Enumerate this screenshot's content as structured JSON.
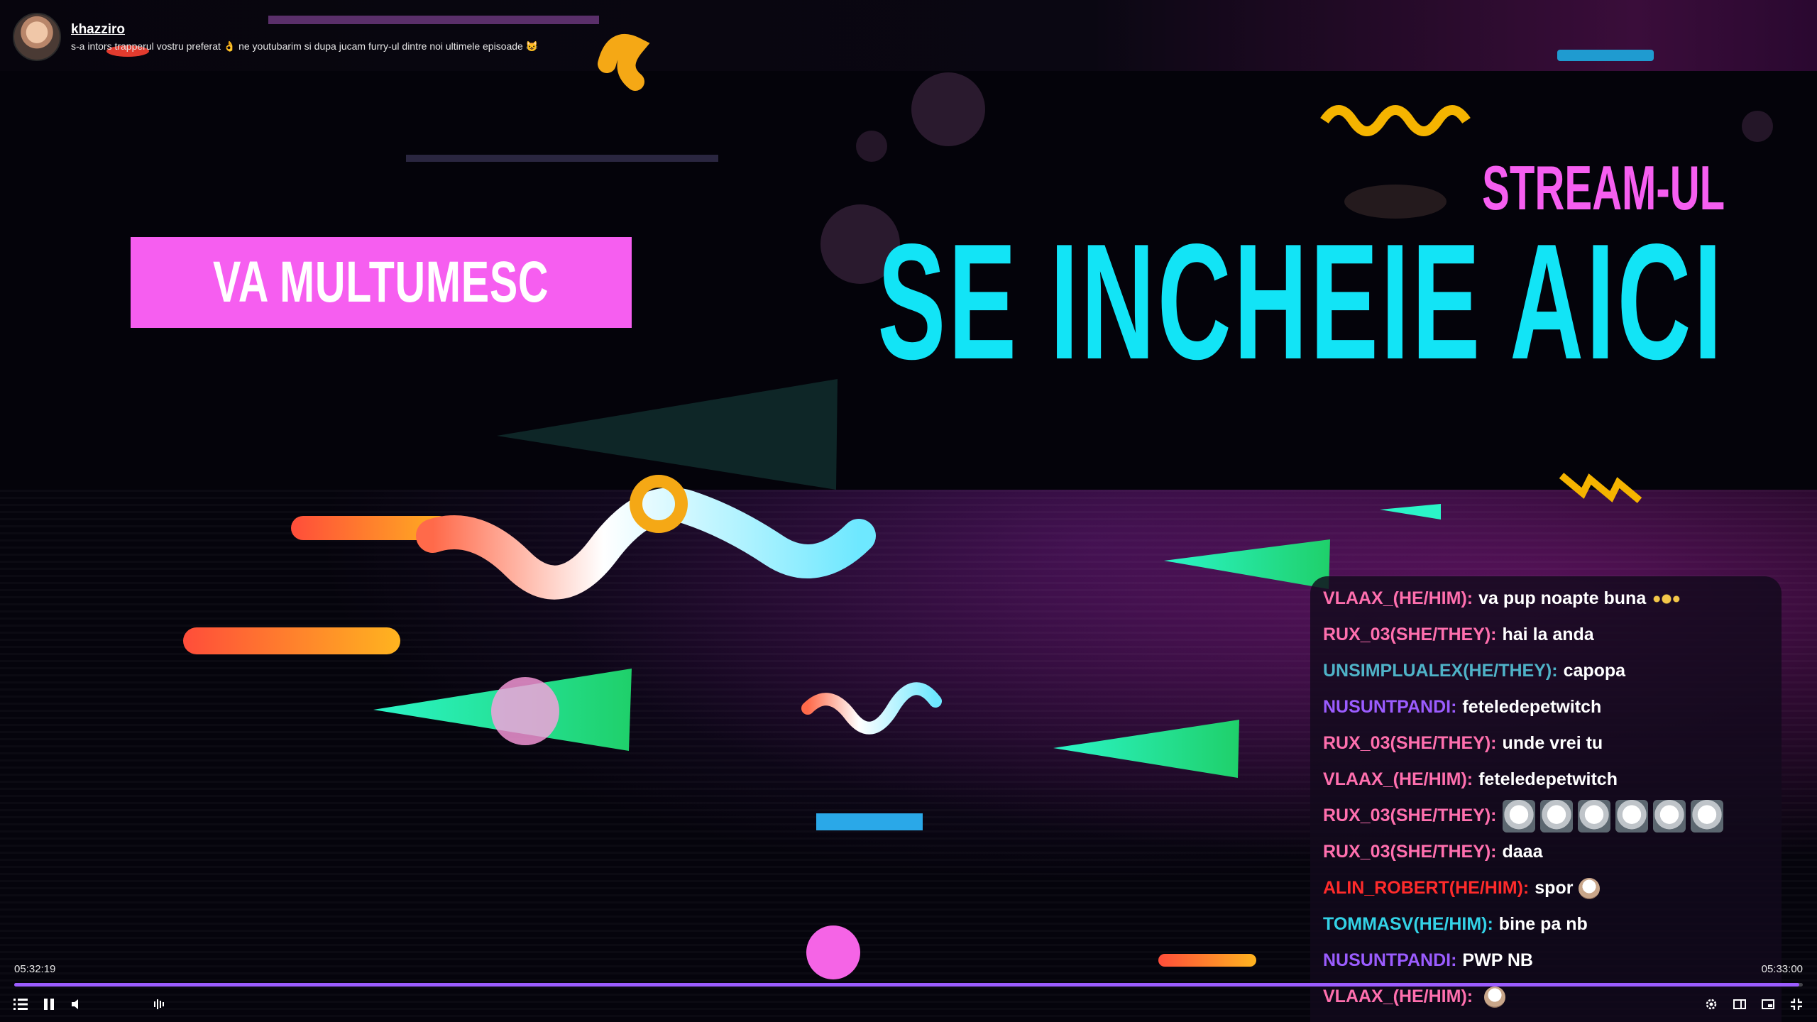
{
  "header": {
    "channel": "khazziro",
    "title": "s-a intors trapperul vostru preferat 👌 ne youtubarim si dupa jucam furry-ul dintre noi ultimele episoade 😺"
  },
  "scene": {
    "banner_text": "VA MULTUMESC",
    "heading_small": "STREAM-UL",
    "heading_big": "SE INCHEIE AICI"
  },
  "chat": [
    {
      "user": "VLAAX_(HE/HIM):",
      "color": "#ff6fae",
      "msg": "va pup noapte buna",
      "emote": "dots"
    },
    {
      "user": "RUX_03(SHE/THEY):",
      "color": "#ff6fae",
      "msg": "hai la anda"
    },
    {
      "user": "UNSIMPLUALEX(HE/THEY):",
      "color": "#4fb3c8",
      "msg": "capopa"
    },
    {
      "user": "NUSUNTPANDI:",
      "color": "#9b5cff",
      "msg": "feteledepetwitch"
    },
    {
      "user": "RUX_03(SHE/THEY):",
      "color": "#ff6fae",
      "msg": "unde vrei tu"
    },
    {
      "user": "VLAAX_(HE/HIM):",
      "color": "#ff6fae",
      "msg": "feteledepetwitch"
    },
    {
      "user": "RUX_03(SHE/THEY):",
      "color": "#ff6fae",
      "msg": "",
      "emote": "dogs"
    },
    {
      "user": "RUX_03(SHE/THEY):",
      "color": "#ff6fae",
      "msg": "daaa"
    },
    {
      "user": "ALIN_ROBERT(HE/HIM):",
      "color": "#ff2b2b",
      "msg": "spor",
      "emote": "small"
    },
    {
      "user": "TOMMASV(HE/HIM):",
      "color": "#33d2e6",
      "msg": "bine pa nb"
    },
    {
      "user": "NUSUNTPANDI:",
      "color": "#9b5cff",
      "msg": "PWP NB"
    },
    {
      "user": "VLAAX_(HE/HIM):",
      "color": "#ff6fae",
      "msg": "",
      "emote": "small"
    }
  ],
  "player": {
    "time_current": "05:32:19",
    "time_total": "05:33:00",
    "progress_fraction": 0.998,
    "accent": "#9b5cff",
    "icons_left": [
      "chapters-icon",
      "pause-icon",
      "volume-icon"
    ],
    "icons_right": [
      "settings-icon",
      "theatre-mode-icon",
      "pip-icon",
      "exit-fullscreen-icon"
    ]
  }
}
